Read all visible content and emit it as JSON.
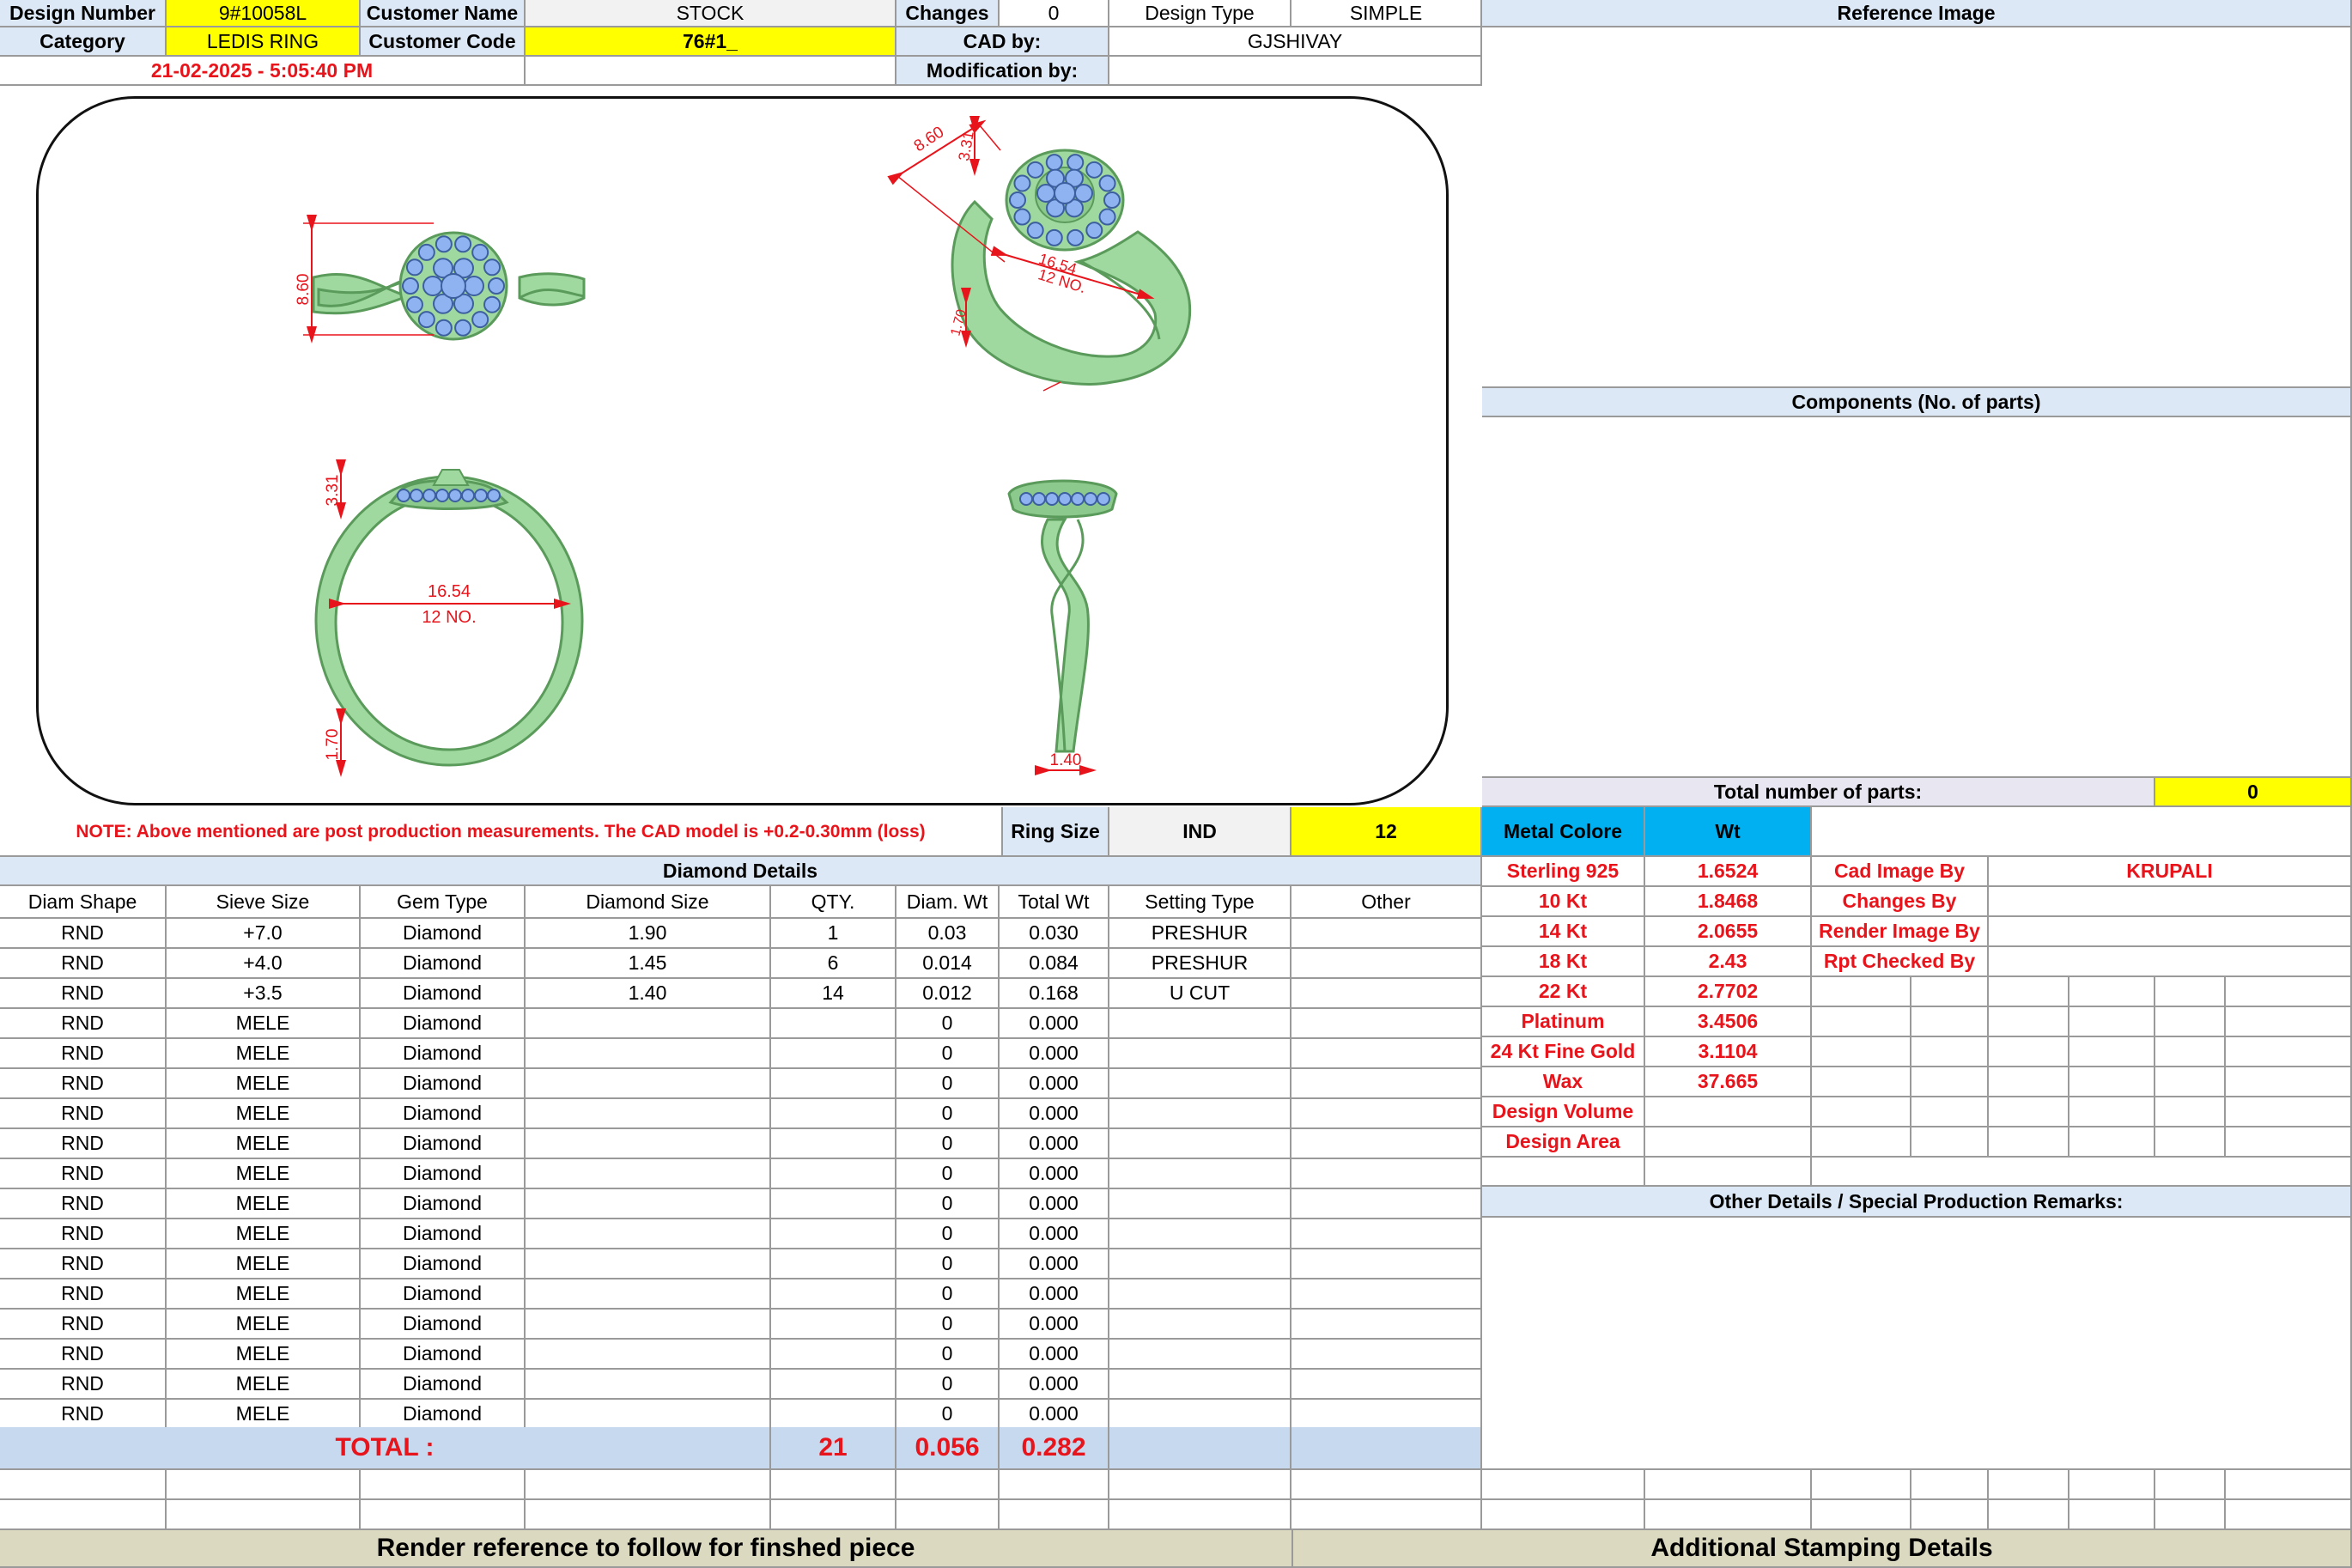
{
  "header": {
    "design_number_label": "Design Number",
    "design_number": "9#10058L",
    "customer_name_label": "Customer Name",
    "customer_name": "STOCK",
    "changes_label": "Changes",
    "changes": "0",
    "design_type_label": "Design Type",
    "design_type": "SIMPLE",
    "category_label": "Category",
    "category": "LEDIS RING",
    "customer_code_label": "Customer Code",
    "customer_code": "76#1_",
    "cad_by_label": "CAD by:",
    "cad_by": "GJSHIVAY",
    "timestamp": "21-02-2025 - 5:05:40 PM",
    "modification_label": "Modification by:",
    "modification": ""
  },
  "drawing": {
    "dims": {
      "top_height": "8.60",
      "persp_width": "8.60",
      "persp_height": "3.31",
      "persp_inner": "16.54",
      "persp_size": "12 NO.",
      "persp_shank": "1.70",
      "front_height": "3.31",
      "front_inner": "16.54",
      "front_size": "12 NO.",
      "front_shank": "1.70",
      "side_shank": "1.40"
    }
  },
  "colors": {
    "metal": "#9fd99f",
    "metal_dark": "#5a9a5a",
    "stone": "#8fb3f0",
    "dimension": "#e8141b"
  },
  "right_panel": {
    "reference_image_label": "Reference Image",
    "components_label": "Components (No. of parts)",
    "total_parts_label": "Total number of parts:",
    "total_parts": "0",
    "other_details_label": "Other Details / Special Production Remarks:"
  },
  "note": "NOTE: Above mentioned are post production measurements. The CAD model is +0.2-0.30mm (loss)",
  "ring_size": {
    "label": "Ring Size",
    "standard": "IND",
    "value": "12"
  },
  "metal": {
    "label": "Metal Colore",
    "wt_label": "Wt",
    "rows": [
      {
        "name": "Sterling 925",
        "wt": "1.6524"
      },
      {
        "name": "10 Kt",
        "wt": "1.8468"
      },
      {
        "name": "14 Kt",
        "wt": "2.0655"
      },
      {
        "name": "18 Kt",
        "wt": "2.43"
      },
      {
        "name": "22 Kt",
        "wt": "2.7702"
      },
      {
        "name": "Platinum",
        "wt": "3.4506"
      },
      {
        "name": "24 Kt Fine Gold",
        "wt": "3.1104"
      },
      {
        "name": "Wax",
        "wt": "37.665"
      },
      {
        "name": "Design Volume",
        "wt": ""
      },
      {
        "name": "Design Area",
        "wt": ""
      }
    ]
  },
  "credits": [
    {
      "label": "Cad Image By",
      "value": "KRUPALI"
    },
    {
      "label": "Changes By",
      "value": ""
    },
    {
      "label": "Render Image By",
      "value": ""
    },
    {
      "label": "Rpt Checked By",
      "value": ""
    }
  ],
  "diamond": {
    "title": "Diamond Details",
    "columns": [
      "Diam Shape",
      "Sieve Size",
      "Gem Type",
      "Diamond Size",
      "QTY.",
      "Diam. Wt",
      "Total Wt",
      "Setting Type",
      "Other"
    ],
    "rows": [
      [
        "RND",
        "+7.0",
        "Diamond",
        "1.90",
        "1",
        "0.03",
        "0.030",
        "PRESHUR",
        ""
      ],
      [
        "RND",
        "+4.0",
        "Diamond",
        "1.45",
        "6",
        "0.014",
        "0.084",
        "PRESHUR",
        ""
      ],
      [
        "RND",
        "+3.5",
        "Diamond",
        "1.40",
        "14",
        "0.012",
        "0.168",
        "U CUT",
        ""
      ],
      [
        "RND",
        "MELE",
        "Diamond",
        "",
        "",
        "0",
        "0.000",
        "",
        ""
      ],
      [
        "RND",
        "MELE",
        "Diamond",
        "",
        "",
        "0",
        "0.000",
        "",
        ""
      ],
      [
        "RND",
        "MELE",
        "Diamond",
        "",
        "",
        "0",
        "0.000",
        "",
        ""
      ],
      [
        "RND",
        "MELE",
        "Diamond",
        "",
        "",
        "0",
        "0.000",
        "",
        ""
      ],
      [
        "RND",
        "MELE",
        "Diamond",
        "",
        "",
        "0",
        "0.000",
        "",
        ""
      ],
      [
        "RND",
        "MELE",
        "Diamond",
        "",
        "",
        "0",
        "0.000",
        "",
        ""
      ],
      [
        "RND",
        "MELE",
        "Diamond",
        "",
        "",
        "0",
        "0.000",
        "",
        ""
      ],
      [
        "RND",
        "MELE",
        "Diamond",
        "",
        "",
        "0",
        "0.000",
        "",
        ""
      ],
      [
        "RND",
        "MELE",
        "Diamond",
        "",
        "",
        "0",
        "0.000",
        "",
        ""
      ],
      [
        "RND",
        "MELE",
        "Diamond",
        "",
        "",
        "0",
        "0.000",
        "",
        ""
      ],
      [
        "RND",
        "MELE",
        "Diamond",
        "",
        "",
        "0",
        "0.000",
        "",
        ""
      ],
      [
        "RND",
        "MELE",
        "Diamond",
        "",
        "",
        "0",
        "0.000",
        "",
        ""
      ],
      [
        "RND",
        "MELE",
        "Diamond",
        "",
        "",
        "0",
        "0.000",
        "",
        ""
      ],
      [
        "RND",
        "MELE",
        "Diamond",
        "",
        "",
        "0",
        "0.000",
        "",
        ""
      ]
    ],
    "total_label": "TOTAL :",
    "total_qty": "21",
    "total_diam_wt": "0.056",
    "total_wt": "0.282"
  },
  "footer": {
    "render_reference": "Render reference to follow for finshed piece",
    "stamping": "Additional Stamping Details"
  }
}
